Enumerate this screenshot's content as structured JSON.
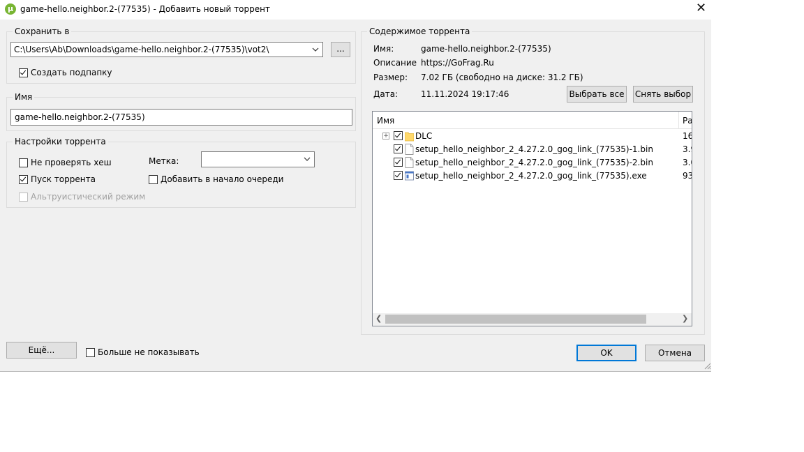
{
  "window": {
    "title": "game-hello.neighbor.2-(77535) - Добавить новый торрент",
    "close_glyph": "✕",
    "app_icon_glyph": "µ"
  },
  "save": {
    "legend": "Сохранить в",
    "path": "C:\\Users\\Ab\\Downloads\\game-hello.neighbor.2-(77535)\\vot2\\",
    "browse_label": "...",
    "subfolder_label": "Создать подпапку",
    "subfolder_checked": true
  },
  "name": {
    "legend": "Имя",
    "value": "game-hello.neighbor.2-(77535)"
  },
  "settings": {
    "legend": "Настройки торрента",
    "skip_hash_label": "Не проверять хеш",
    "skip_hash_checked": false,
    "start_label": "Пуск торрента",
    "start_checked": true,
    "altruist_label": "Альтруистический режим",
    "altruist_checked": false,
    "label_caption": "Метка:",
    "label_value": "",
    "queue_top_label": "Добавить в начало очереди",
    "queue_top_checked": false
  },
  "contents": {
    "legend": "Содержимое торрента",
    "name_label": "Имя:",
    "name_value": "game-hello.neighbor.2-(77535)",
    "desc_label": "Описание",
    "desc_value": "https://GoFrag.Ru",
    "size_label": "Размер:",
    "size_value": "7.02 ГБ (свободно на диске: 31.2 ГБ)",
    "date_label": "Дата:",
    "date_value": "11.11.2024 19:17:46",
    "select_all_label": "Выбрать все",
    "deselect_label": "Снять выбор",
    "col_name": "Имя",
    "col_size": "Ра",
    "files": [
      {
        "name": "DLC",
        "size": "16",
        "type": "folder-icon",
        "expandable": true,
        "checked": true
      },
      {
        "name": "setup_hello_neighbor_2_4.27.2.0_gog_link_(77535)-1.bin",
        "size": "3.9",
        "type": "file-icon",
        "expandable": false,
        "checked": true
      },
      {
        "name": "setup_hello_neighbor_2_4.27.2.0_gog_link_(77535)-2.bin",
        "size": "3.0",
        "type": "file-icon",
        "expandable": false,
        "checked": true
      },
      {
        "name": "setup_hello_neighbor_2_4.27.2.0_gog_link_(77535).exe",
        "size": "93",
        "type": "exe-icon",
        "expandable": false,
        "checked": true
      }
    ]
  },
  "footer": {
    "more_label": "Ещё...",
    "dont_show_label": "Больше не показывать",
    "dont_show_checked": false,
    "ok_label": "OK",
    "cancel_label": "Отмена"
  },
  "colors": {
    "window_bg": "#f0f0f0",
    "accent": "#0078d7",
    "folder": "#ffd86b",
    "app_icon": "#78b533"
  }
}
